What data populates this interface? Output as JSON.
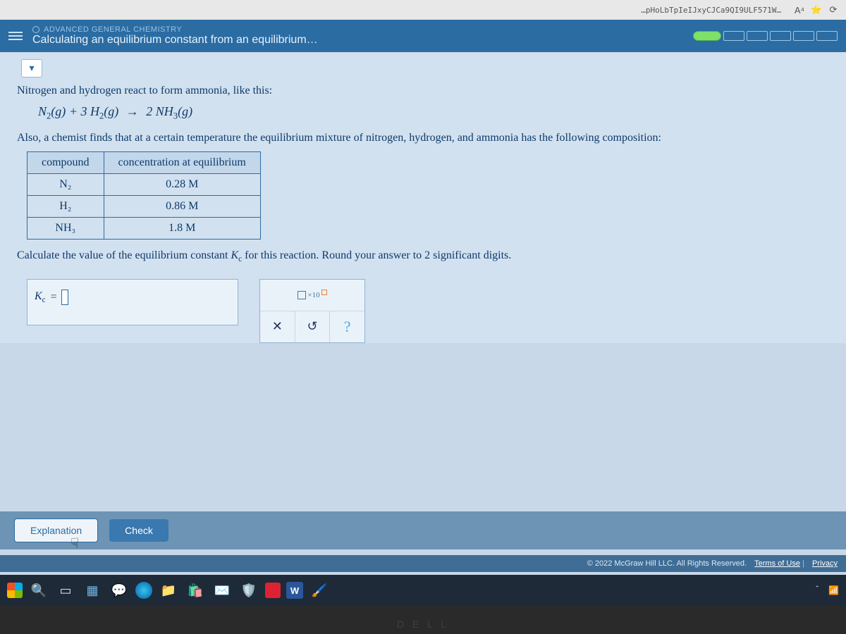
{
  "browser": {
    "url_fragment": "…pHoLbTpIeIJxyCJCa9QI9ULF571W…",
    "read_aloud": "A⁴",
    "favorites": "⭐"
  },
  "header": {
    "course": "ADVANCED GENERAL CHEMISTRY",
    "lesson": "Calculating an equilibrium constant from an equilibrium…"
  },
  "problem": {
    "intro": "Nitrogen and hydrogen react to form ammonia, like this:",
    "equation_lhs_1": "N",
    "equation_lhs_1_sub": "2",
    "equation_lhs_1_phase": "(g)",
    "plus": " + ",
    "coef2": "3 H",
    "equation_lhs_2_sub": "2",
    "equation_lhs_2_phase": "(g)",
    "arrow": "→",
    "rhs_coef": "2 NH",
    "rhs_sub": "3",
    "rhs_phase": "(g)",
    "context": "Also, a chemist finds that at a certain temperature the equilibrium mixture of nitrogen, hydrogen, and ammonia has the following composition:",
    "table": {
      "head_compound": "compound",
      "head_conc": "concentration at equilibrium",
      "rows": [
        {
          "compound": "N₂",
          "conc": "0.28 M"
        },
        {
          "compound": "H₂",
          "conc": "0.86 M"
        },
        {
          "compound": "NH₃",
          "conc": "1.8 M"
        }
      ]
    },
    "prompt_a": "Calculate the value of the equilibrium constant ",
    "prompt_kc": "K",
    "prompt_kc_sub": "c",
    "prompt_b": " for this reaction. Round your answer to 2 significant digits.",
    "answer_label_k": "K",
    "answer_label_sub": "c",
    "answer_eq": " = "
  },
  "tools": {
    "sci": "×10",
    "clear": "✕",
    "reset": "↺",
    "help": "?"
  },
  "footer": {
    "explanation": "Explanation",
    "check": "Check"
  },
  "legal": {
    "copyright": "© 2022 McGraw Hill LLC. All Rights Reserved.",
    "terms": "Terms of Use",
    "privacy": "Privacy"
  },
  "taskbar": {
    "word": "W"
  }
}
